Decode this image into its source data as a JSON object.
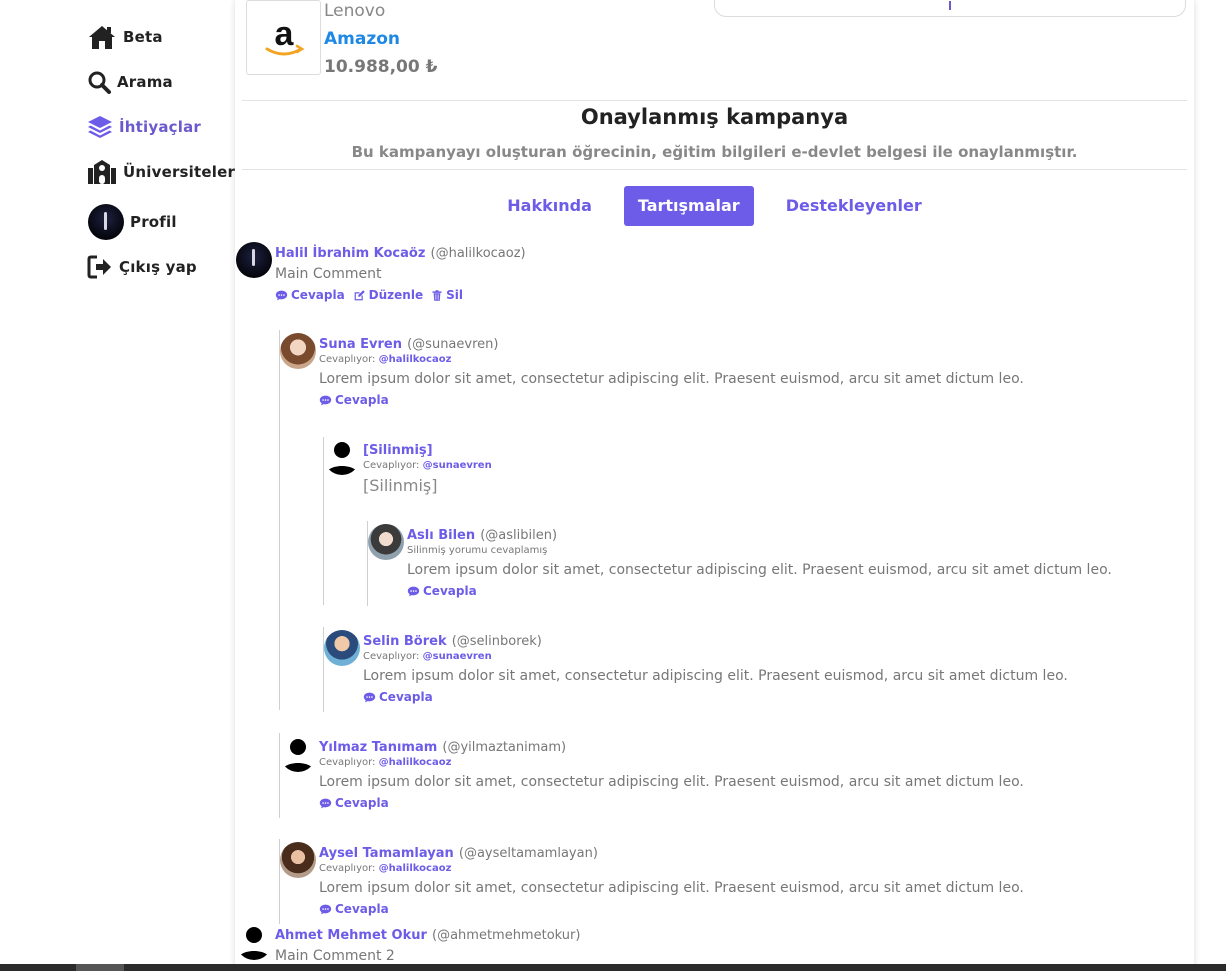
{
  "sidebar": {
    "items": [
      {
        "label": "Beta",
        "icon": "home-icon"
      },
      {
        "label": "Arama",
        "icon": "search-icon"
      },
      {
        "label": "İhtiyaçlar",
        "icon": "layers-icon",
        "active": true
      },
      {
        "label": "Üniversiteler",
        "icon": "university-icon"
      },
      {
        "label": "Profil",
        "icon": "avatar"
      },
      {
        "label": "Çıkış yap",
        "icon": "sign-out-icon"
      }
    ]
  },
  "product": {
    "brand": "Lenovo",
    "store": "Amazon",
    "price": "10.988,00 ₺",
    "logo_letter": "a"
  },
  "campaign": {
    "title": "Onaylanmış kampanya",
    "subtitle": "Bu kampanyayı oluşturan öğrecinin, eğitim bilgileri e-devlet belgesi ile onaylanmıştır."
  },
  "tabs": [
    {
      "label": "Hakkında",
      "active": false
    },
    {
      "label": "Tartışmalar",
      "active": true
    },
    {
      "label": "Destekleyenler",
      "active": false
    }
  ],
  "labels": {
    "replying_to": "Cevaplıyor:",
    "reply": "Cevapla",
    "edit": "Düzenle",
    "delete": "Sil"
  },
  "comments": [
    {
      "name": "Halil İbrahim Kocaöz",
      "handle": "(@halilkocaoz)",
      "text": "Main Comment"
    },
    {
      "name": "Suna Evren",
      "handle": "(@sunaevren)",
      "reply_to": "@halilkocaoz",
      "text": "Lorem ipsum dolor sit amet, consectetur adipiscing elit. Praesent euismod, arcu sit amet dictum leo."
    },
    {
      "name": "[Silinmiş]",
      "reply_to": "@sunaevren",
      "text": "[Silinmiş]"
    },
    {
      "name": "Aslı Bilen",
      "handle": "(@aslibilen)",
      "note": "Silinmiş yorumu cevaplamış",
      "text": "Lorem ipsum dolor sit amet, consectetur adipiscing elit. Praesent euismod, arcu sit amet dictum leo."
    },
    {
      "name": "Selin Börek",
      "handle": "(@selinborek)",
      "reply_to": "@sunaevren",
      "text": "Lorem ipsum dolor sit amet, consectetur adipiscing elit. Praesent euismod, arcu sit amet dictum leo."
    },
    {
      "name": "Yılmaz Tanımam",
      "handle": "(@yilmaztanimam)",
      "reply_to": "@halilkocaoz",
      "text": "Lorem ipsum dolor sit amet, consectetur adipiscing elit. Praesent euismod, arcu sit amet dictum leo."
    },
    {
      "name": "Aysel Tamamlayan",
      "handle": "(@ayseltamamlayan)",
      "reply_to": "@halilkocaoz",
      "text": "Lorem ipsum dolor sit amet, consectetur adipiscing elit. Praesent euismod, arcu sit amet dictum leo."
    },
    {
      "name": "Ahmet Mehmet Okur",
      "handle": "(@ahmetmehmetokur)",
      "text": "Main Comment 2"
    }
  ],
  "colors": {
    "accent": "#6c5ce7",
    "link_blue": "#1e88e5"
  }
}
